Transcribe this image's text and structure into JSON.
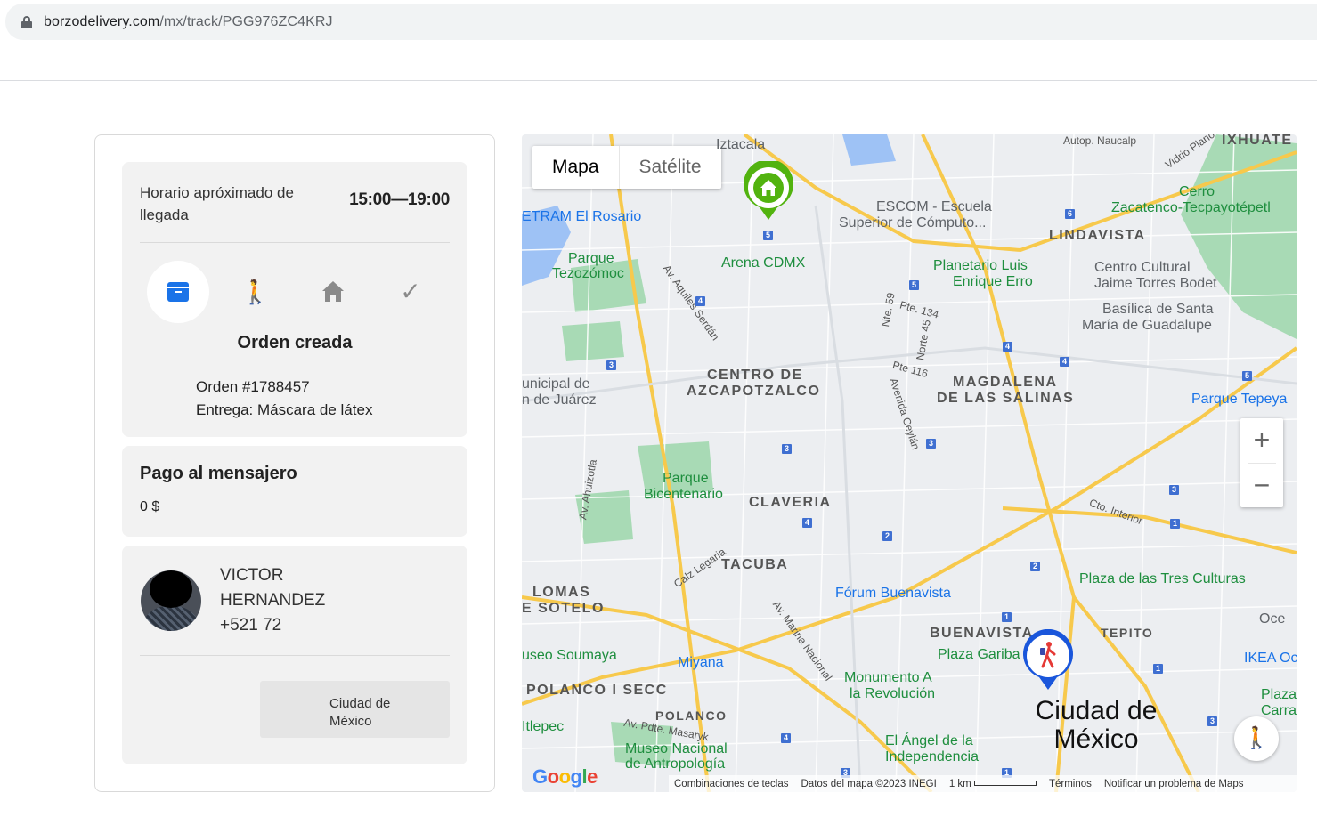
{
  "browser": {
    "url_host": "borzodelivery.com",
    "url_path": "/mx/track/PGG976ZC4KRJ"
  },
  "order": {
    "eta_label": "Horario apróximado de llegada",
    "eta_value": "15:00—19:00",
    "status_title": "Orden creada",
    "order_number": "Orden #1788457",
    "delivery": "Entrega: Máscara de látex",
    "steps": [
      {
        "icon": "box-icon",
        "active": true
      },
      {
        "icon": "courier-walking-icon",
        "active": false
      },
      {
        "icon": "house-icon",
        "active": false
      },
      {
        "icon": "check-icon",
        "active": false
      }
    ]
  },
  "payment": {
    "title": "Pago al mensajero",
    "amount": "0 $"
  },
  "courier": {
    "name_line1": "VICTOR",
    "name_line2": "HERNANDEZ",
    "phone": "+521 72",
    "city_line1": "Ciudad de",
    "city_line2": "México"
  },
  "map": {
    "toggle": {
      "map": "Mapa",
      "satellite": "Satélite"
    },
    "labels": {
      "iztacala": "Iztacala",
      "autop": "Autop. Naucalp",
      "ixhuate": "IXHUATE",
      "vidrio": "Vidrio Plano",
      "cetram": "ETRAM El Rosario",
      "escom1": "ESCOM - Escuela",
      "escom2": "Superior de Cómputo...",
      "cerro1": "Cerro",
      "cerro2": "Zacatenco-Tecpayotépetl",
      "lindavista": "LINDAVISTA",
      "parque_tez1": "Parque",
      "parque_tez2": "Tezozómoc",
      "arena": "Arena CDMX",
      "planetario1": "Planetario Luis",
      "planetario2": "Enrique Erro",
      "centro_cult1": "Centro Cultural",
      "centro_cult2": "Jaime Torres Bodet",
      "basilica1": "Basílica de Santa",
      "basilica2": "María de Guadalupe",
      "aquiles": "Av. Aquiles Serdán",
      "nte59": "Nte. 59",
      "pte134": "Pte. 134",
      "norte45": "Norte 45",
      "pte116": "Pte 116",
      "centro_azc1": "CENTRO DE",
      "centro_azc2": "AZCAPOTZALCO",
      "magdalena1": "MAGDALENA",
      "magdalena2": "DE LAS SALINAS",
      "municipal1": "unicipal de",
      "municipal2": "n de Juárez",
      "parque_tepeyac": "Parque Tepeya",
      "ceylan": "Avenida Ceylán",
      "ahuizotla": "Av. Ahuizotla",
      "bicentenario1": "Parque",
      "bicentenario2": "Bicentenario",
      "claveria": "CLAVERIA",
      "cto_interior": "Cto. Interior",
      "tacuba": "TACUBA",
      "legaria": "Calz Legaria",
      "lomas1": "LOMAS",
      "lomas2": "E SOTELO",
      "forum": "Fórum Buenavista",
      "tres_culturas": "Plaza de las Tres Culturas",
      "marina": "Av. Marina Nacional",
      "oce": "Oce",
      "buenavista": "BUENAVISTA",
      "tepito": "TEPITO",
      "soumaya": "useo Soumaya",
      "miyana": "Miyana",
      "plaza_garibaldi": "Plaza Gariba",
      "ikea": "IKEA Oc",
      "monumento1": "Monumento A",
      "monumento2": "la Revolución",
      "polanco_secc": "POLANCO I SECC",
      "plaza_carr1": "Plaza C",
      "plaza_carr2": "Carranz",
      "polanco": "POLANCO",
      "masaryk": "Av. Pdte. Masaryk",
      "itlepec": "Itlepec",
      "museo1": "Museo Nacional",
      "museo2": "de Antropología",
      "angel1": "El Ángel de la",
      "angel2": "Independencia",
      "cdmx1": "Ciudad de",
      "cdmx2": "México"
    },
    "footer": {
      "shortcuts": "Combinaciones de teclas",
      "data": "Datos del mapa ©2023 INEGI",
      "scale": "1 km",
      "terms": "Términos",
      "report": "Notificar un problema de Maps"
    },
    "google": "Google",
    "zoom_in": "+",
    "zoom_out": "−",
    "colors": {
      "pickup_pin": "#52b30f",
      "courier_pin": "#1a56db",
      "road_major": "#f7c94c",
      "park": "#a8dab5",
      "water": "#9ec2f5"
    }
  }
}
